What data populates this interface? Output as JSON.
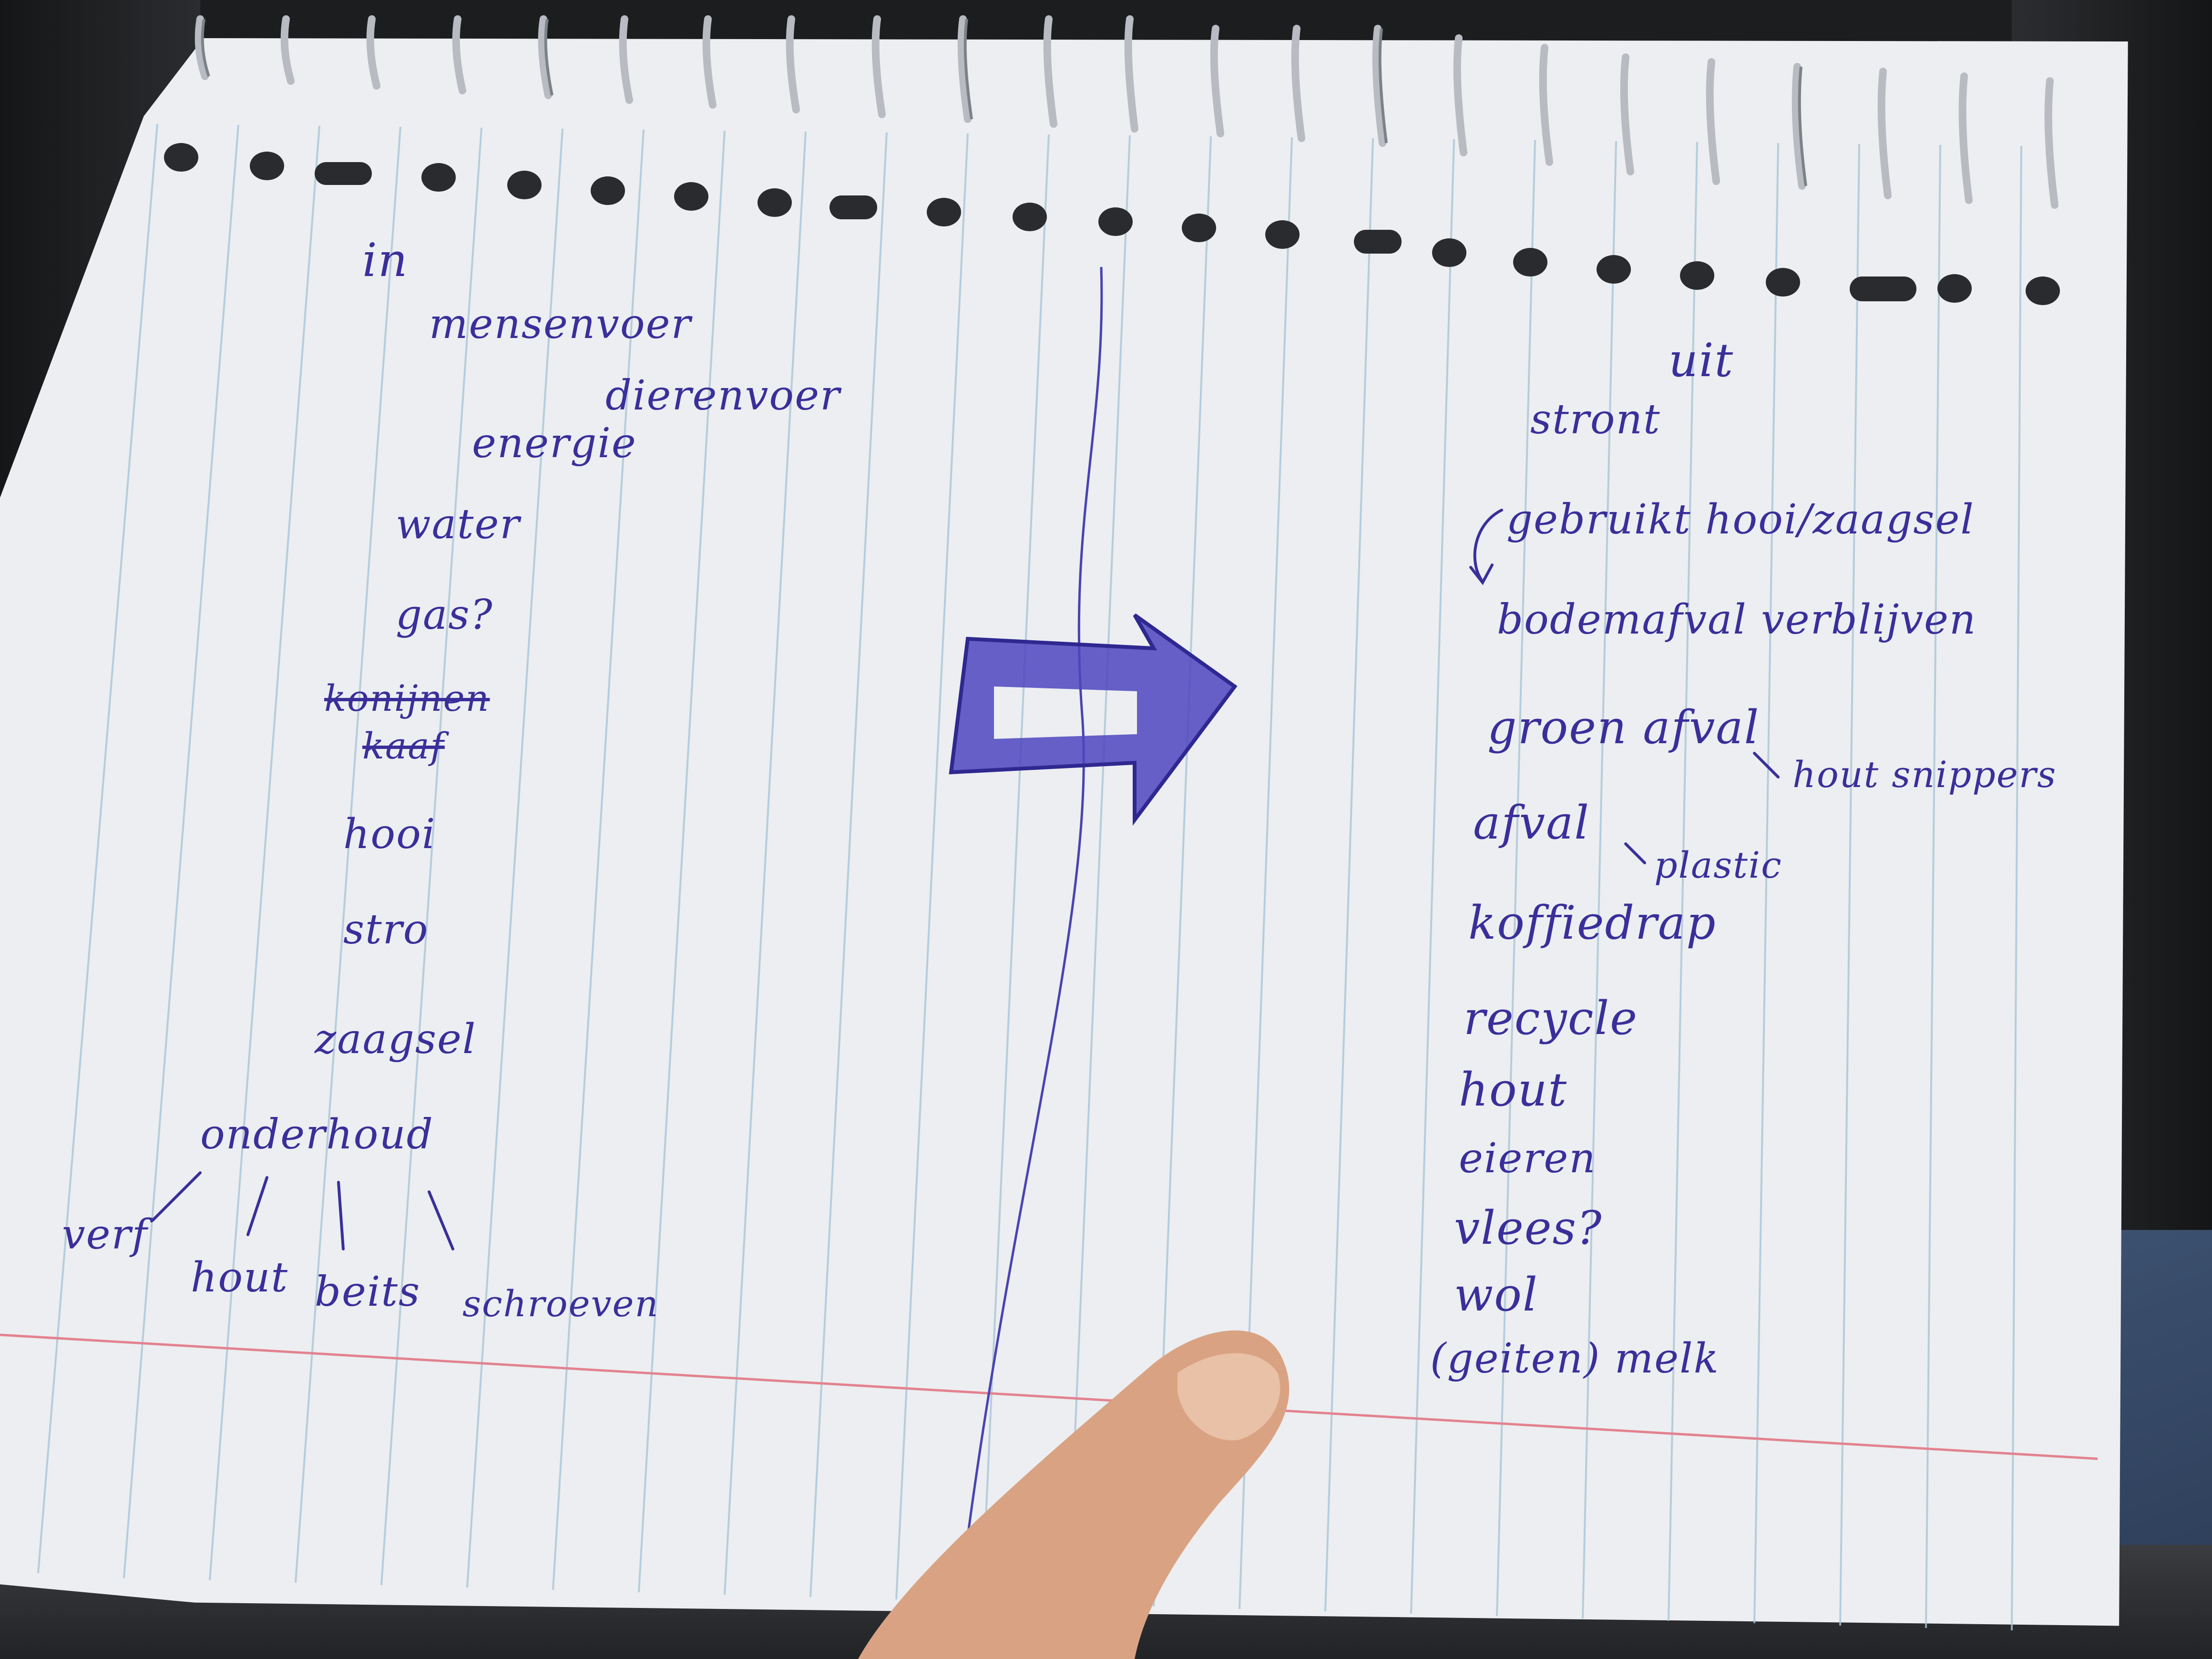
{
  "notebook": {
    "in_column": {
      "heading": "in",
      "items": [
        "mensenvoer",
        "dierenvoer",
        "energie",
        "water",
        "gas?",
        "konijnen",
        "kaaf",
        "hooi",
        "stro",
        "zaagsel",
        "onderhoud"
      ],
      "onderhoud_items": [
        "verf",
        "hout",
        "beits",
        "schroeven"
      ]
    },
    "uit_column": {
      "heading": "uit",
      "items": [
        "stront",
        "gebruikt hooi/zaagsel",
        "bodemafval verblijven",
        "groen afval",
        "afval",
        "koffiedrap",
        "recycle",
        "hout",
        "eieren",
        "vlees?",
        "wol",
        "(geiten) melk"
      ],
      "groen_afval_sub": "hout snippers",
      "afval_sub": "plastic"
    }
  },
  "colors": {
    "ink": "#3a2f9a",
    "paper": "#eceef1",
    "rule_line": "#a9c4d6",
    "margin_line": "#e3828f",
    "skin": "#d9a383"
  },
  "icons": [
    "arrow-right-icon",
    "spiral-binding-icon"
  ]
}
